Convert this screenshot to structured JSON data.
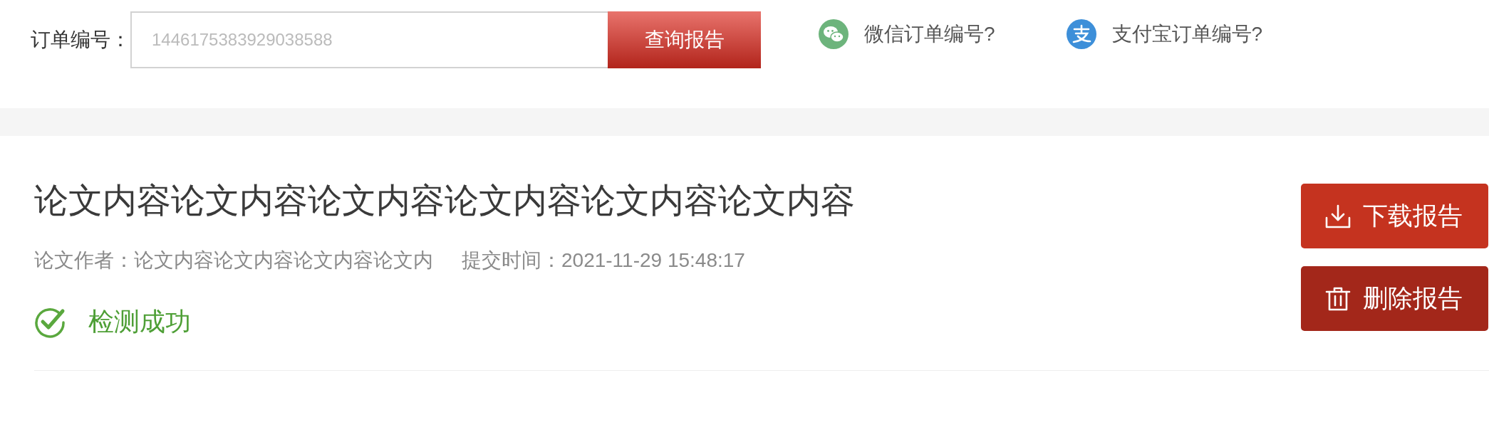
{
  "search": {
    "label": "订单编号：",
    "placeholder": "1446175383929038588",
    "button": "查询报告"
  },
  "help_links": [
    {
      "kind": "wechat",
      "label": "微信订单编号?"
    },
    {
      "kind": "alipay",
      "label": "支付宝订单编号?"
    }
  ],
  "report": {
    "title": "论文内容论文内容论文内容论文内容论文内容论文内容",
    "author": "论文作者：论文内容论文内容论文内容论文内",
    "submitted": "提交时间：2021-11-29 15:48:17",
    "status": {
      "kind": "success",
      "label": "检测成功"
    },
    "actions": [
      {
        "kind": "download",
        "label": "下载报告"
      },
      {
        "kind": "delete",
        "label": "删除报告"
      }
    ]
  }
}
